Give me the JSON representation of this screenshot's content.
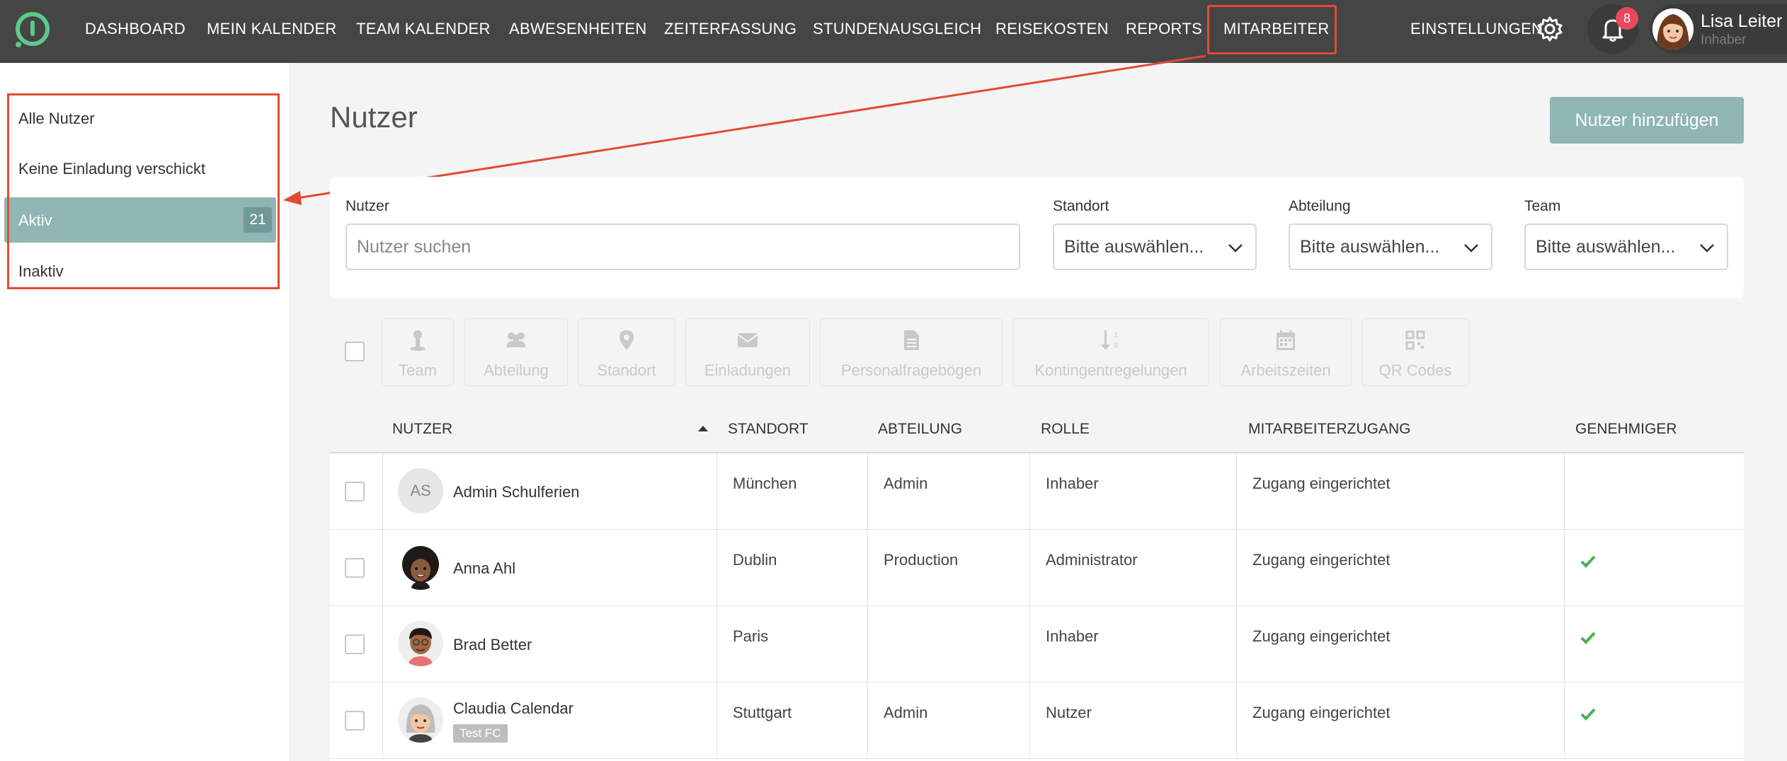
{
  "nav": {
    "items": [
      "DASHBOARD",
      "MEIN KALENDER",
      "TEAM KALENDER",
      "ABWESENHEITEN",
      "ZEITERFASSUNG",
      "STUNDENAUSGLEICH",
      "REISEKOSTEN",
      "REPORTS",
      "MITARBEITER"
    ],
    "settings": "EINSTELLUNGEN",
    "notifications": "8",
    "user_name": "Lisa Leiter",
    "user_role": "Inhaber"
  },
  "sidebar": {
    "items": [
      {
        "label": "Alle Nutzer"
      },
      {
        "label": "Keine Einladung verschickt"
      },
      {
        "label": "Aktiv",
        "count": "21"
      },
      {
        "label": "Inaktiv"
      }
    ]
  },
  "main": {
    "title": "Nutzer",
    "add_button": "Nutzer hinzufügen"
  },
  "filters": {
    "user_label": "Nutzer",
    "user_placeholder": "Nutzer suchen",
    "location_label": "Standort",
    "location_value": "Bitte auswählen...",
    "department_label": "Abteilung",
    "department_value": "Bitte auswählen...",
    "team_label": "Team",
    "team_value": "Bitte auswählen..."
  },
  "bulk_actions": [
    "Team",
    "Abteilung",
    "Standort",
    "Einladungen",
    "Personalfragebögen",
    "Kontingentregelungen",
    "Arbeitszeiten",
    "QR Codes"
  ],
  "table": {
    "headers": [
      "NUTZER",
      "STANDORT",
      "ABTEILUNG",
      "ROLLE",
      "MITARBEITERZUGANG",
      "GENEHMIGER"
    ],
    "rows": [
      {
        "initials": "AS",
        "name": "Admin Schulferien",
        "location": "München",
        "department": "Admin",
        "role": "Inhaber",
        "access": "Zugang eingerichtet",
        "approver": false
      },
      {
        "name": "Anna Ahl",
        "location": "Dublin",
        "department": "Production",
        "role": "Administrator",
        "access": "Zugang eingerichtet",
        "approver": true
      },
      {
        "name": "Brad Better",
        "location": "Paris",
        "department": "",
        "role": "Inhaber",
        "access": "Zugang eingerichtet",
        "approver": true
      },
      {
        "name": "Claudia Calendar",
        "tag": "Test FC",
        "location": "Stuttgart",
        "department": "Admin",
        "role": "Nutzer",
        "access": "Zugang eingerichtet",
        "approver": true
      }
    ]
  },
  "colors": {
    "topbar": "#454545",
    "accent": "#8fb5b4",
    "annotation": "#e14b32",
    "check": "#4caf50",
    "badge": "#e8475c"
  }
}
